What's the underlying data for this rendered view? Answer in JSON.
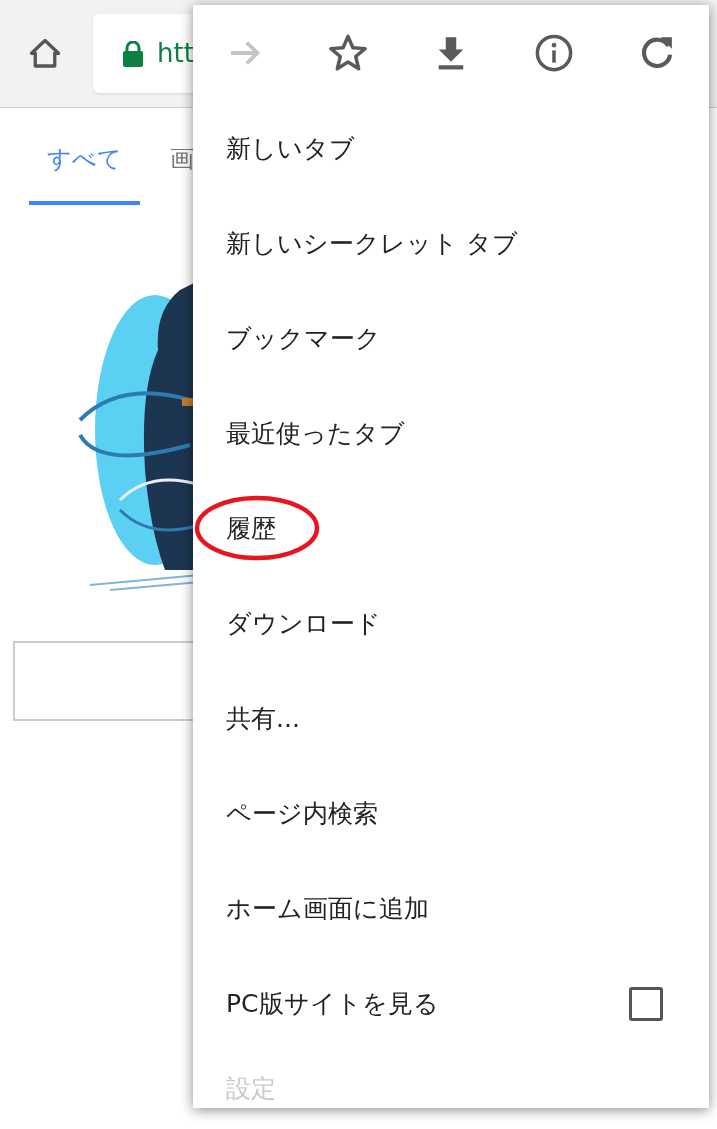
{
  "toolbar": {
    "url": "htt"
  },
  "page": {
    "tabs": [
      {
        "label": "すべて",
        "selected": true
      },
      {
        "label": "画",
        "selected": false
      }
    ]
  },
  "menu": {
    "actions": [
      {
        "kind": "forward",
        "disabled": true
      },
      {
        "kind": "star",
        "disabled": false
      },
      {
        "kind": "download",
        "disabled": false
      },
      {
        "kind": "info",
        "disabled": false
      },
      {
        "kind": "reload",
        "disabled": false
      }
    ],
    "items": [
      {
        "label": "新しいタブ",
        "circled": false
      },
      {
        "label": "新しいシークレット タブ",
        "circled": false
      },
      {
        "label": "ブックマーク",
        "circled": false
      },
      {
        "label": "最近使ったタブ",
        "circled": false
      },
      {
        "label": "履歴",
        "circled": true
      },
      {
        "label": "ダウンロード",
        "circled": false
      },
      {
        "label": "共有...",
        "circled": false
      },
      {
        "label": "ページ内検索",
        "circled": false
      },
      {
        "label": "ホーム画面に追加",
        "circled": false
      },
      {
        "label": "PC版サイトを見る",
        "circled": false,
        "kind": "checkbox",
        "checked": false
      },
      {
        "label": "設定",
        "circled": false,
        "faded": true
      }
    ]
  }
}
